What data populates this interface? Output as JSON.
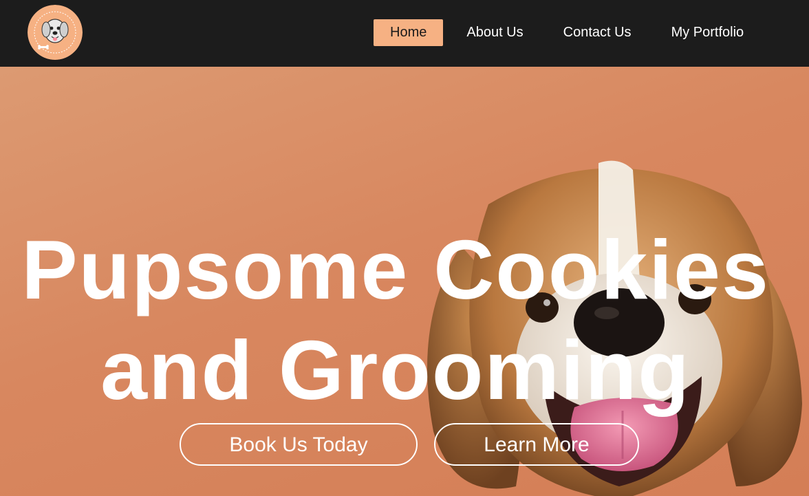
{
  "brand": {
    "name": "Pupsome Cookies and Grooming",
    "logo_icon": "dog-badge-icon",
    "colors": {
      "nav_bg": "#1c1c1c",
      "accent": "#f6b183",
      "hero_bg": "#d8875f",
      "text_light": "#ffffff"
    }
  },
  "nav": {
    "items": [
      {
        "label": "Home",
        "active": true
      },
      {
        "label": "About Us",
        "active": false
      },
      {
        "label": "Contact Us",
        "active": false
      },
      {
        "label": "My Portfolio",
        "active": false
      }
    ]
  },
  "hero": {
    "title_line1": "Pupsome Cookies",
    "title_line2": "and Grooming",
    "buttons": {
      "book": "Book Us Today",
      "learn": "Learn More"
    }
  }
}
